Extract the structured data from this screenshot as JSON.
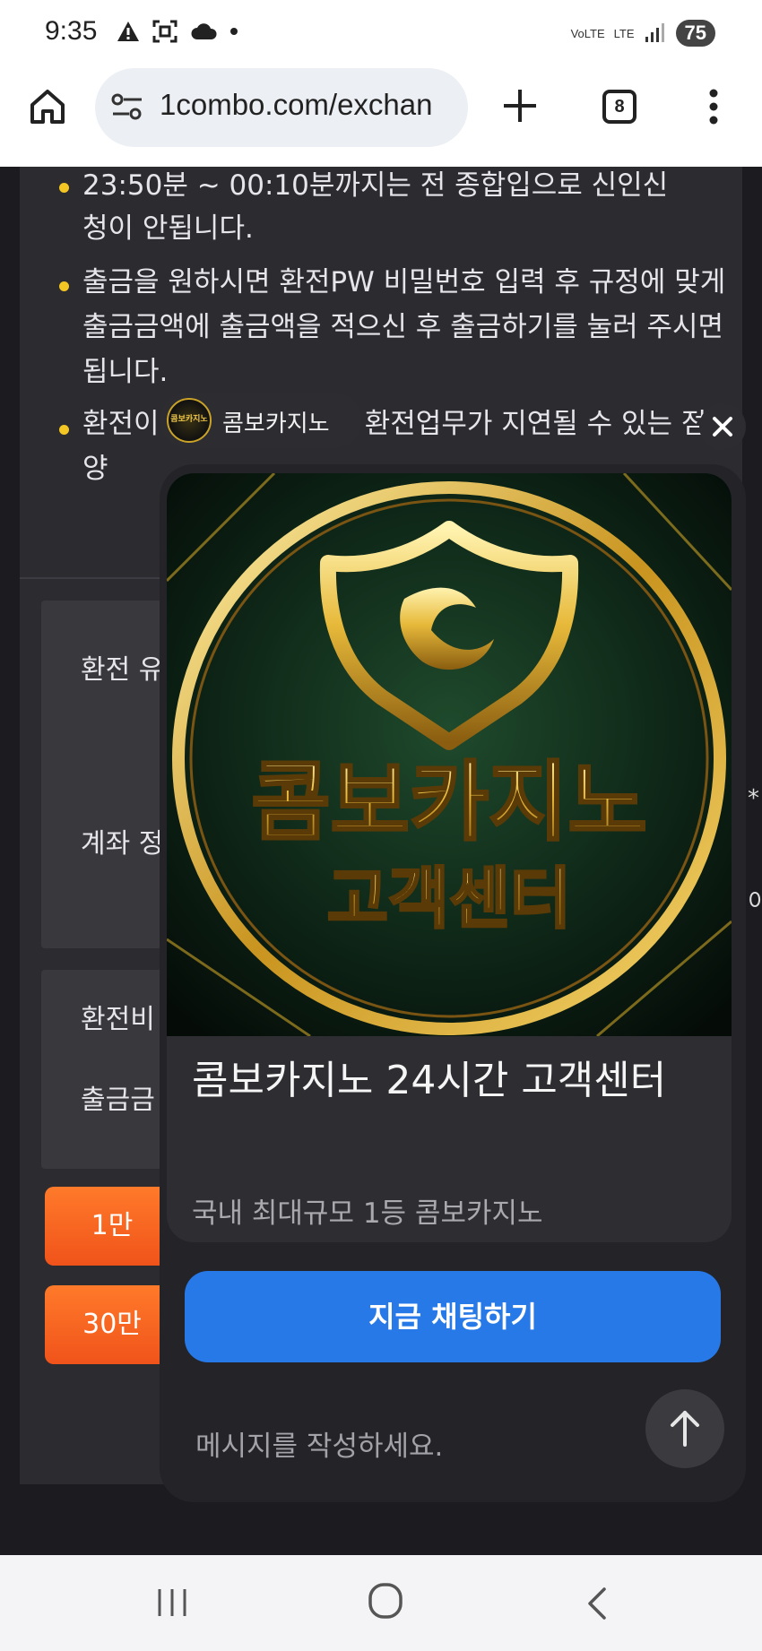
{
  "status_bar": {
    "time": "9:35",
    "network": "VoLTE",
    "network2": "LTE",
    "battery": "75",
    "icons": [
      "warning-icon",
      "screenshot-icon",
      "cloud-icon",
      "dot-icon",
      "signal-icon"
    ]
  },
  "browser": {
    "url": "1combo.com/exchan",
    "tab_count": "8",
    "icons": [
      "home-icon",
      "tune-icon",
      "plus-icon",
      "tabs-icon",
      "menu-icon"
    ]
  },
  "page": {
    "notices": [
      "23:50분 ~ 00:10분까지는 전 종합입으로 신인신",
      "청이 안됩니다.",
      "출금을 원하시면 환전PW 비밀번호 입력 후 규정에 맞게 출금금액에 출금액을 적으신 후 출금하기를 눌러 주시면 됩니다.",
      "환전이 몰리는 시간에는 환전업무가 지연될 수 있는 점 양"
    ],
    "box1_labels": [
      "환전 유",
      "계좌 정"
    ],
    "box2_labels": [
      "환전비",
      "출금금"
    ],
    "amount_buttons": [
      "1만",
      "30만"
    ],
    "edge_chars": [
      "*",
      "이"
    ]
  },
  "chat_widget": {
    "brand_name": "콤보카지노",
    "brand_logo_text": "콤보카지노",
    "image_title": "콤보카지노",
    "image_subtitle": "고객센터",
    "card_title": "콤보카지노 24시간 고객센터",
    "card_subtitle": "국내 최대규모 1등 콤보카지노",
    "chat_button": "지금 채팅하기",
    "message_placeholder": "메시지를 작성하세요.",
    "icons": [
      "close-icon",
      "shield-logo-icon",
      "arrow-up-icon"
    ],
    "colors": {
      "accent": "#2779e8",
      "gold": "#e7b93a",
      "orange": "#f0531a"
    }
  },
  "nav_bar": {
    "icons": [
      "recents-icon",
      "home-circle-icon",
      "back-icon"
    ]
  }
}
